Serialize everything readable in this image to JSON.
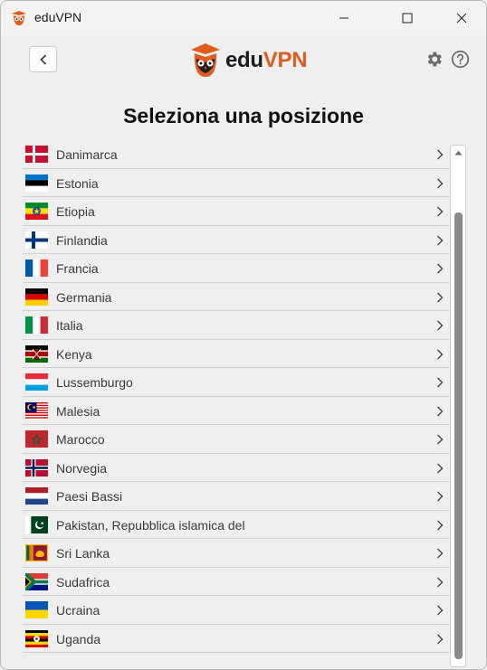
{
  "window": {
    "title": "eduVPN",
    "icon": "eduvpn-owl-icon"
  },
  "header": {
    "back_icon": "chevron-left-icon",
    "logo_prefix": "edu",
    "logo_suffix": "VPN",
    "settings_icon": "gear-icon",
    "help_icon": "help-icon"
  },
  "page": {
    "title": "Seleziona una posizione"
  },
  "locations": [
    {
      "name": "Danimarca",
      "flag": "dk"
    },
    {
      "name": "Estonia",
      "flag": "ee"
    },
    {
      "name": "Etiopia",
      "flag": "et"
    },
    {
      "name": "Finlandia",
      "flag": "fi"
    },
    {
      "name": "Francia",
      "flag": "fr"
    },
    {
      "name": "Germania",
      "flag": "de"
    },
    {
      "name": "Italia",
      "flag": "it"
    },
    {
      "name": "Kenya",
      "flag": "ke"
    },
    {
      "name": "Lussemburgo",
      "flag": "lu"
    },
    {
      "name": "Malesia",
      "flag": "my"
    },
    {
      "name": "Marocco",
      "flag": "ma"
    },
    {
      "name": "Norvegia",
      "flag": "no"
    },
    {
      "name": "Paesi Bassi",
      "flag": "nl"
    },
    {
      "name": "Pakistan, Repubblica islamica del",
      "flag": "pk"
    },
    {
      "name": "Sri Lanka",
      "flag": "lk"
    },
    {
      "name": "Sudafrica",
      "flag": "za"
    },
    {
      "name": "Ucraina",
      "flag": "ua"
    },
    {
      "name": "Uganda",
      "flag": "ug"
    }
  ],
  "colors": {
    "accent": "#e15b1f",
    "text": "#1e1e1e",
    "background": "#efefef"
  }
}
